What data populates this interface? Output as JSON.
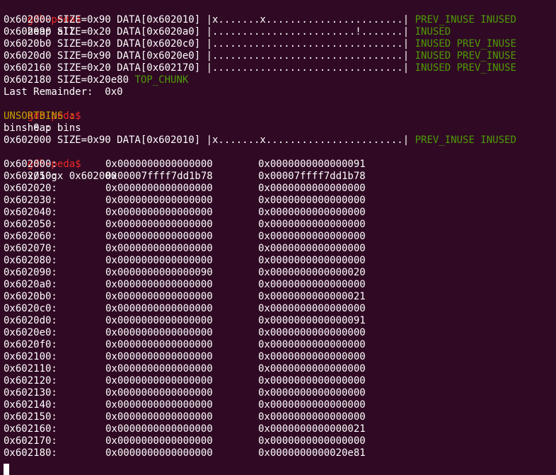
{
  "prompt": "gdb-peda$",
  "commands": {
    "heap_all": "heap all",
    "heap_bins": "heap bins",
    "examine": "x/50gx 0x602000"
  },
  "heap_all_chunks": [
    {
      "info": "0x602000 SIZE=0x90 DATA[0x602010] |x.......x.......................| ",
      "flags": "PREV_INUSE INUSED"
    },
    {
      "info": "0x602090 SIZE=0x20 DATA[0x6020a0] |........................!.......| ",
      "flags": "INUSED"
    },
    {
      "info": "0x6020b0 SIZE=0x20 DATA[0x6020c0] |................................| ",
      "flags": "INUSED PREV_INUSE"
    },
    {
      "info": "0x6020d0 SIZE=0x90 DATA[0x6020e0] |................................| ",
      "flags": "INUSED PREV_INUSE"
    },
    {
      "info": "0x602160 SIZE=0x20 DATA[0x602170] |................................| ",
      "flags": "INUSED PREV_INUSE"
    }
  ],
  "top_chunk": {
    "info": "0x602180 SIZE=0x20e80 ",
    "label": "TOP_CHUNK"
  },
  "last_remainder": "Last Remainder:  0x0",
  "unsortbins_label": "UNSORTBINS :",
  "bins_label": "bins 0 :",
  "bin_chunk": {
    "info": "0x602000 SIZE=0x90 DATA[0x602010] |x.......x.......................| ",
    "flags": "PREV_INUSE INUSED"
  },
  "memory_dump": [
    {
      "addr": "0x602000:",
      "w1": "0x0000000000000000",
      "w2": "0x0000000000000091"
    },
    {
      "addr": "0x602010:",
      "w1": "0x00007ffff7dd1b78",
      "w2": "0x00007ffff7dd1b78"
    },
    {
      "addr": "0x602020:",
      "w1": "0x0000000000000000",
      "w2": "0x0000000000000000"
    },
    {
      "addr": "0x602030:",
      "w1": "0x0000000000000000",
      "w2": "0x0000000000000000"
    },
    {
      "addr": "0x602040:",
      "w1": "0x0000000000000000",
      "w2": "0x0000000000000000"
    },
    {
      "addr": "0x602050:",
      "w1": "0x0000000000000000",
      "w2": "0x0000000000000000"
    },
    {
      "addr": "0x602060:",
      "w1": "0x0000000000000000",
      "w2": "0x0000000000000000"
    },
    {
      "addr": "0x602070:",
      "w1": "0x0000000000000000",
      "w2": "0x0000000000000000"
    },
    {
      "addr": "0x602080:",
      "w1": "0x0000000000000000",
      "w2": "0x0000000000000000"
    },
    {
      "addr": "0x602090:",
      "w1": "0x0000000000000090",
      "w2": "0x0000000000000020"
    },
    {
      "addr": "0x6020a0:",
      "w1": "0x0000000000000000",
      "w2": "0x0000000000000000"
    },
    {
      "addr": "0x6020b0:",
      "w1": "0x0000000000000000",
      "w2": "0x0000000000000021"
    },
    {
      "addr": "0x6020c0:",
      "w1": "0x0000000000000000",
      "w2": "0x0000000000000000"
    },
    {
      "addr": "0x6020d0:",
      "w1": "0x0000000000000000",
      "w2": "0x0000000000000091"
    },
    {
      "addr": "0x6020e0:",
      "w1": "0x0000000000000000",
      "w2": "0x0000000000000000"
    },
    {
      "addr": "0x6020f0:",
      "w1": "0x0000000000000000",
      "w2": "0x0000000000000000"
    },
    {
      "addr": "0x602100:",
      "w1": "0x0000000000000000",
      "w2": "0x0000000000000000"
    },
    {
      "addr": "0x602110:",
      "w1": "0x0000000000000000",
      "w2": "0x0000000000000000"
    },
    {
      "addr": "0x602120:",
      "w1": "0x0000000000000000",
      "w2": "0x0000000000000000"
    },
    {
      "addr": "0x602130:",
      "w1": "0x0000000000000000",
      "w2": "0x0000000000000000"
    },
    {
      "addr": "0x602140:",
      "w1": "0x0000000000000000",
      "w2": "0x0000000000000000"
    },
    {
      "addr": "0x602150:",
      "w1": "0x0000000000000000",
      "w2": "0x0000000000000000"
    },
    {
      "addr": "0x602160:",
      "w1": "0x0000000000000000",
      "w2": "0x0000000000000021"
    },
    {
      "addr": "0x602170:",
      "w1": "0x0000000000000000",
      "w2": "0x0000000000000000"
    },
    {
      "addr": "0x602180:",
      "w1": "0x0000000000000000",
      "w2": "0x0000000000020e81"
    }
  ],
  "colors": {
    "background": "#300a24",
    "prompt": "#ef2929",
    "text": "#ffffff",
    "flags": "#4e9a06",
    "unsortbins": "#c4a000"
  }
}
